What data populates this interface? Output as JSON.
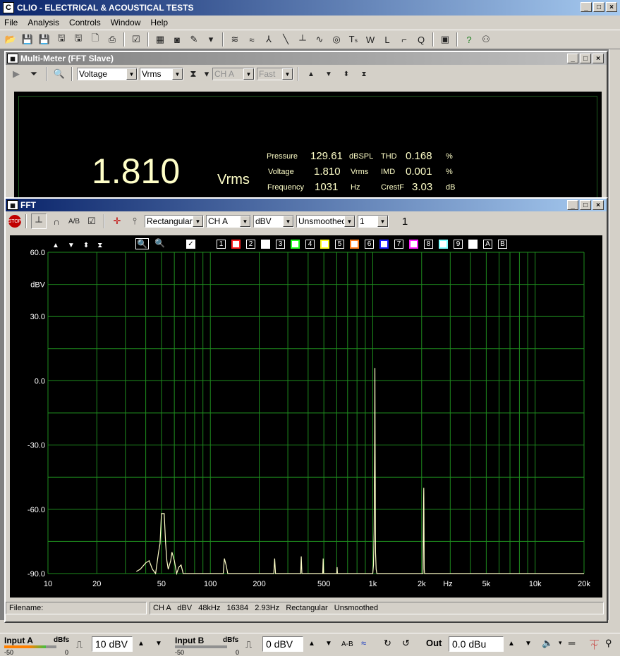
{
  "app": {
    "title": "CLIO - ELECTRICAL & ACOUSTICAL TESTS",
    "icon_letter": "C"
  },
  "menu": [
    "File",
    "Analysis",
    "Controls",
    "Window",
    "Help"
  ],
  "multimeter": {
    "title": "Multi-Meter (FFT Slave)",
    "measure_select": "Voltage",
    "unit_select": "Vrms",
    "channel_select": "CH A",
    "speed_select": "Fast",
    "big_value": "1.810",
    "big_unit": "Vrms",
    "readings": [
      {
        "label": "Pressure",
        "value": "129.61",
        "unit": "dBSPL"
      },
      {
        "label": "Voltage",
        "value": "1.810",
        "unit": "Vrms"
      },
      {
        "label": "Frequency",
        "value": "1031",
        "unit": "Hz"
      }
    ],
    "distortion": [
      {
        "label": "THD",
        "value": "0.168",
        "unit": "%"
      },
      {
        "label": "IMD",
        "value": "0.001",
        "unit": "%"
      },
      {
        "label": "CrestF",
        "value": "3.03",
        "unit": "dB"
      }
    ]
  },
  "fft": {
    "title": "FFT",
    "window_select": "Rectangular",
    "channel_select": "CH A",
    "unit_select": "dBV",
    "smoothing_select": "Unsmoothed",
    "average_select": "1",
    "average_count": "1",
    "memory_labels": [
      "1",
      "2",
      "3",
      "4",
      "5",
      "6",
      "7",
      "8",
      "9",
      "A",
      "B"
    ],
    "memory_colors": [
      "#ff2020",
      "#ffffff",
      "#20ff20",
      "#ffff20",
      "#ff8020",
      "#2020ff",
      "#ff20ff",
      "#80ffff",
      "#ffffff"
    ],
    "filename_label": "Filename:",
    "status_text": "CH A   dBV   48kHz   16384   2.93Hz   Rectangular   Unsmoothed"
  },
  "chart_data": {
    "type": "line",
    "ylabel": "dBV",
    "xlabel": "Hz",
    "x_scale": "log",
    "xlim": [
      10,
      20000
    ],
    "ylim": [
      -90,
      60
    ],
    "y_ticks": [
      "60.0",
      "30.0",
      "0.0",
      "-30.0",
      "-60.0",
      "-90.0"
    ],
    "x_ticks": [
      "10",
      "20",
      "50",
      "100",
      "200",
      "500",
      "1k",
      "2k",
      "5k",
      "10k",
      "20k"
    ],
    "grid": true,
    "trace_color": "#ffffc8",
    "grid_color": "#1e8c1e",
    "series": [
      {
        "values": [
          [
            35,
            -89
          ],
          [
            37,
            -88
          ],
          [
            40,
            -85
          ],
          [
            42,
            -84
          ],
          [
            44,
            -88
          ],
          [
            46,
            -90
          ],
          [
            48,
            -80
          ],
          [
            49,
            -76
          ],
          [
            50,
            -62
          ],
          [
            51,
            -62
          ],
          [
            52,
            -62
          ],
          [
            53,
            -76
          ],
          [
            54,
            -84
          ],
          [
            55,
            -88
          ],
          [
            57,
            -84
          ],
          [
            58,
            -80
          ],
          [
            60,
            -84
          ],
          [
            62,
            -90
          ],
          [
            64,
            -87
          ],
          [
            66,
            -86
          ],
          [
            68,
            -90
          ],
          [
            120,
            -90
          ],
          [
            122,
            -83
          ],
          [
            125,
            -86
          ],
          [
            128,
            -90
          ],
          [
            246,
            -90
          ],
          [
            249,
            -83
          ],
          [
            252,
            -90
          ],
          [
            360,
            -90
          ],
          [
            363,
            -82
          ],
          [
            366,
            -90
          ],
          [
            492,
            -90
          ],
          [
            495,
            -83
          ],
          [
            498,
            -90
          ],
          [
            600,
            -90
          ],
          [
            603,
            -87
          ],
          [
            606,
            -90
          ],
          [
            1000,
            -90
          ],
          [
            1010,
            -86
          ],
          [
            1020,
            -70
          ],
          [
            1028,
            -30
          ],
          [
            1031,
            6
          ],
          [
            1034,
            -30
          ],
          [
            1040,
            -80
          ],
          [
            1050,
            -88
          ],
          [
            1060,
            -90
          ],
          [
            2040,
            -90
          ],
          [
            2050,
            -70
          ],
          [
            2058,
            -55
          ],
          [
            2062,
            -50
          ],
          [
            2066,
            -60
          ],
          [
            2075,
            -88
          ],
          [
            2085,
            -90
          ],
          [
            5000,
            -90
          ],
          [
            20000,
            -90
          ]
        ]
      }
    ]
  },
  "bottom": {
    "input_a_label": "Input A",
    "input_a_unit": "dBfs",
    "input_a_scale_low": "-50",
    "input_a_scale_high": "0",
    "input_a_value": "10 dBV",
    "input_b_label": "Input B",
    "input_b_unit": "dBfs",
    "input_b_scale_low": "-50",
    "input_b_scale_high": "0",
    "input_b_value": "0 dBV",
    "ab_label": "A-B",
    "out_label": "Out",
    "out_value": "0.0 dBu",
    "input_a_level_pct": 0.8,
    "input_b_level_pct": 0
  }
}
